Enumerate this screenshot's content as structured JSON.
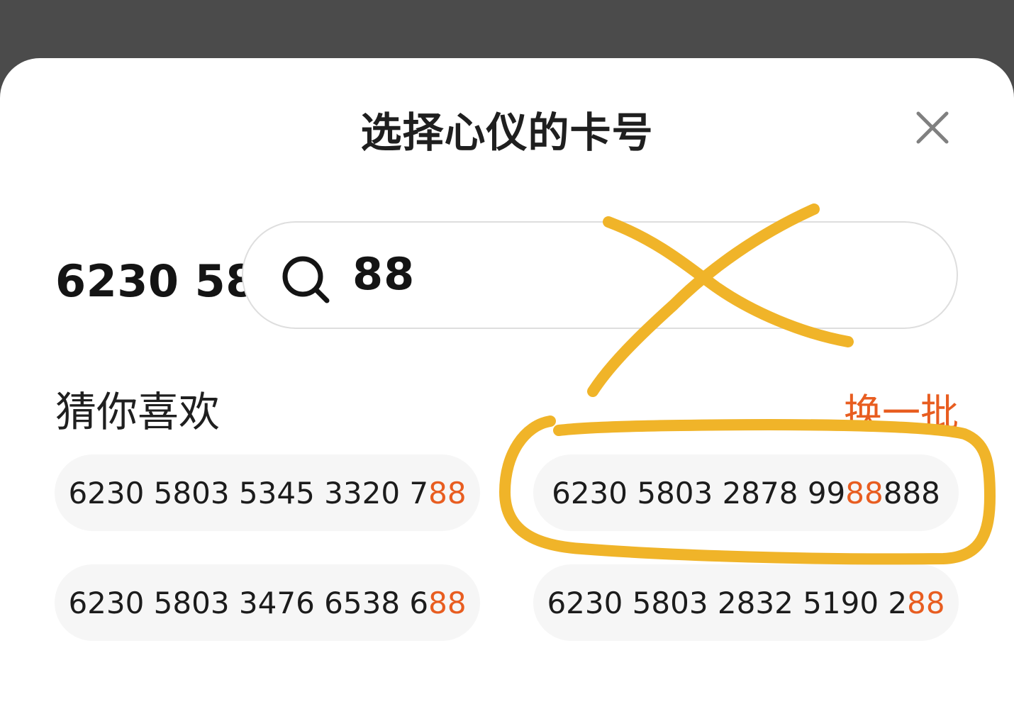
{
  "sheet": {
    "title": "选择心仪的卡号",
    "close_icon": "close-icon"
  },
  "search": {
    "prefix": "6230 58",
    "query": "88",
    "icon": "search-icon"
  },
  "recommend": {
    "title": "猜你喜欢",
    "refresh_label": "换一批",
    "highlight_color": "#e85d20",
    "items": [
      {
        "before": "6230 5803 5345 3320 7",
        "match": "88",
        "after": ""
      },
      {
        "before": "6230 5803 2878 99",
        "match": "88",
        "after": " 888"
      },
      {
        "before": "6230 5803 3476 6538 6",
        "match": "88",
        "after": ""
      },
      {
        "before": "6230 5803 2832 5190 2",
        "match": "88",
        "after": ""
      }
    ]
  },
  "annotation": {
    "color": "#f0b429",
    "marks": [
      "cross-over-search",
      "circle-around-second-number"
    ]
  }
}
